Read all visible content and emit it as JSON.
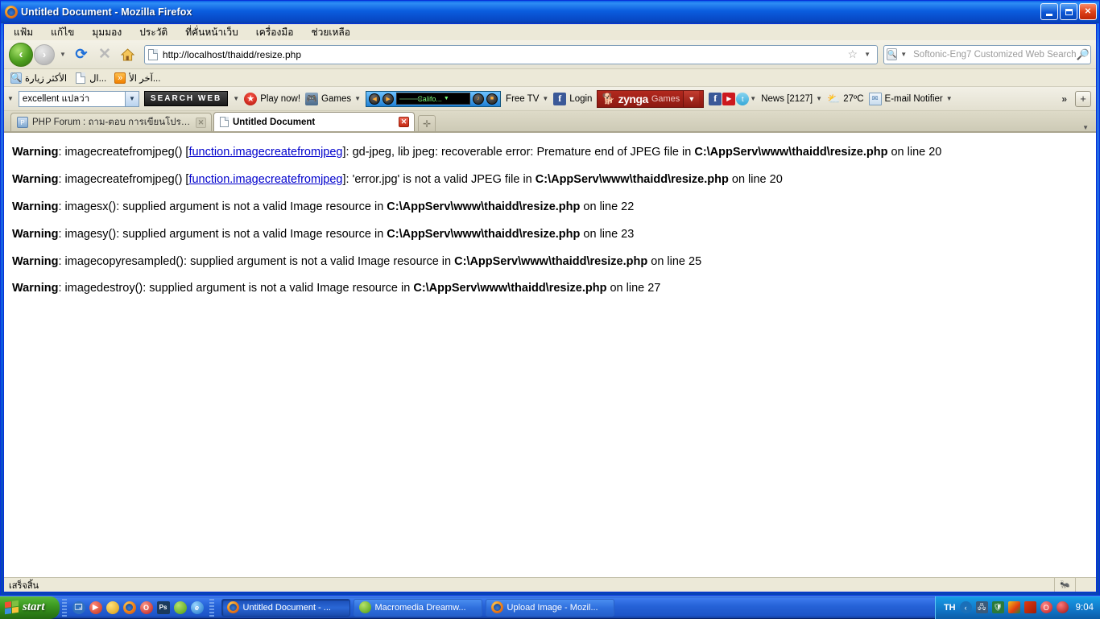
{
  "window": {
    "title": "Untitled Document - Mozilla Firefox",
    "icon": "firefox-icon",
    "minimize_label": "",
    "maximize_label": "",
    "close_label": "✕"
  },
  "menubar": {
    "items": [
      {
        "label": "แฟ้ม",
        "name": "menu-file"
      },
      {
        "label": "แก้ไข",
        "name": "menu-edit"
      },
      {
        "label": "มุมมอง",
        "name": "menu-view"
      },
      {
        "label": "ประวัติ",
        "name": "menu-history"
      },
      {
        "label": "ที่คั่นหน้าเว็บ",
        "name": "menu-bookmarks"
      },
      {
        "label": "เครื่องมือ",
        "name": "menu-tools"
      },
      {
        "label": "ช่วยเหลือ",
        "name": "menu-help"
      }
    ]
  },
  "navbar": {
    "back_glyph": "‹",
    "forward_glyph": "›",
    "history_caret": "▼",
    "reload_glyph": "⟳",
    "stop_glyph": "✕",
    "home_glyph": "🏠",
    "url": "http://localhost/thaidd/resize.php",
    "star_glyph": "☆",
    "star_caret": "▼",
    "search_placeholder": "Softonic-Eng7 Customized Web Search",
    "search_value": "",
    "search_engine_glyph": "🔍",
    "search_engine_caret": "▼",
    "search_go_glyph": "🔎"
  },
  "bookmarks": [
    {
      "label": "الأكثر زيارة",
      "icon": "most-visited-icon",
      "glyph": "🔖"
    },
    {
      "label": "ال...",
      "icon": "page-icon",
      "glyph": ""
    },
    {
      "label": "آخر الأ...",
      "icon": "rss-icon",
      "glyph": "»"
    }
  ],
  "addonbar": {
    "lead_caret": "▼",
    "translate_value": "excellent แปลว่า",
    "translate_caret": "▼",
    "search_web_label": "SEARCH WEB",
    "search_web_caret": "▼",
    "play_now_label": "Play now!",
    "games_label": "Games",
    "games_caret": "▼",
    "radio_station": "Califo...",
    "radio_caret": "▼",
    "free_tv_label": "Free TV",
    "free_tv_caret": "▼",
    "login_label": "Login",
    "facebook_glyph": "f",
    "zynga_word": "zynga",
    "zynga_games": "Games",
    "zynga_caret": "▼",
    "social_caret": "▼",
    "news_label": "News [2127]",
    "news_caret": "▼",
    "weather_temp": "27ºC",
    "email_notifier_label": "E-mail Notifier",
    "email_notifier_caret": "▼",
    "overflow_glyph": "»",
    "plus_glyph": "+"
  },
  "tabs": [
    {
      "label": "PHP Forum : ถาม-ตอบ การเขียนโปรแกร...",
      "active": false,
      "icon": "php-forum-favicon",
      "icon_glyph": "P",
      "close_glyph": "✕"
    },
    {
      "label": "Untitled Document",
      "active": true,
      "icon": "page-favicon",
      "icon_glyph": "",
      "close_glyph": "✕"
    }
  ],
  "tabbar": {
    "newtab_glyph": "✛",
    "listall_glyph": "▼"
  },
  "content": {
    "warnings": [
      {
        "label": "Warning",
        "fn": "imagecreatefromjpeg()",
        "link": "function.imagecreatefromjpeg",
        "message": "gd-jpeg, lib jpeg: recoverable error: Premature end of JPEG file in",
        "path": "C:\\AppServ\\www\\thaidd\\resize.php",
        "line_text": "on line 20"
      },
      {
        "label": "Warning",
        "fn": "imagecreatefromjpeg()",
        "link": "function.imagecreatefromjpeg",
        "message": "'error.jpg' is not a valid JPEG file in",
        "path": "C:\\AppServ\\www\\thaidd\\resize.php",
        "line_text": "on line 20"
      },
      {
        "label": "Warning",
        "fn": "imagesx()",
        "link": "",
        "message": "supplied argument is not a valid Image resource in",
        "path": "C:\\AppServ\\www\\thaidd\\resize.php",
        "line_text": "on line 22"
      },
      {
        "label": "Warning",
        "fn": "imagesy()",
        "link": "",
        "message": "supplied argument is not a valid Image resource in",
        "path": "C:\\AppServ\\www\\thaidd\\resize.php",
        "line_text": "on line 23"
      },
      {
        "label": "Warning",
        "fn": "imagecopyresampled()",
        "link": "",
        "message": "supplied argument is not a valid Image resource in",
        "path": "C:\\AppServ\\www\\thaidd\\resize.php",
        "line_text": "on line 25"
      },
      {
        "label": "Warning",
        "fn": "imagedestroy()",
        "link": "",
        "message": "supplied argument is not a valid Image resource in",
        "path": "C:\\AppServ\\www\\thaidd\\resize.php",
        "line_text": "on line 27"
      }
    ]
  },
  "statusbar": {
    "text": "เสร็จสิ้น",
    "addon_glyph": "🐜"
  },
  "taskbar": {
    "start_label": "start",
    "quicklaunch": [
      {
        "name": "show-desktop-icon",
        "glyph": "🗔",
        "color": "#2f6fbf"
      },
      {
        "name": "media-player-icon",
        "glyph": "▶",
        "color": "#c33"
      },
      {
        "name": "chrome-icon",
        "glyph": "",
        "color": "#d8a21a"
      },
      {
        "name": "firefox-icon",
        "glyph": "",
        "color": "#e06a10"
      },
      {
        "name": "opera-icon",
        "glyph": "O",
        "color": "#c21a1a"
      },
      {
        "name": "photoshop-icon",
        "glyph": "Ps",
        "color": "#1b3a5c"
      },
      {
        "name": "dreamweaver-icon",
        "glyph": "",
        "color": "#4a9a10"
      },
      {
        "name": "internet-explorer-icon",
        "glyph": "e",
        "color": "#1a72c8"
      }
    ],
    "tasks": [
      {
        "label": "Untitled Document - ...",
        "icon": "firefox-icon",
        "active": true
      },
      {
        "label": "Macromedia Dreamw...",
        "icon": "dreamweaver-icon",
        "active": false
      },
      {
        "label": "Upload Image - Mozil...",
        "icon": "firefox-icon",
        "active": false
      }
    ],
    "tray": {
      "language": "TH",
      "icons": [
        {
          "name": "tray-chevron-icon",
          "glyph": "‹",
          "color": "#1a6fb8"
        },
        {
          "name": "tray-network-icon",
          "glyph": "🖧",
          "color": "#3a5a7a"
        },
        {
          "name": "tray-antivirus-icon",
          "glyph": "🛡",
          "color": "#2a7a3a"
        },
        {
          "name": "tray-update-icon",
          "glyph": "▦",
          "color": "#d8a21a"
        },
        {
          "name": "tray-usb-icon",
          "glyph": "⬒",
          "color": "#c0392b"
        },
        {
          "name": "tray-opera-icon",
          "glyph": "O",
          "color": "#c21a1a"
        },
        {
          "name": "tray-security-icon",
          "glyph": "🛡",
          "color": "#b02a2a"
        }
      ],
      "clock": "9:04"
    }
  }
}
